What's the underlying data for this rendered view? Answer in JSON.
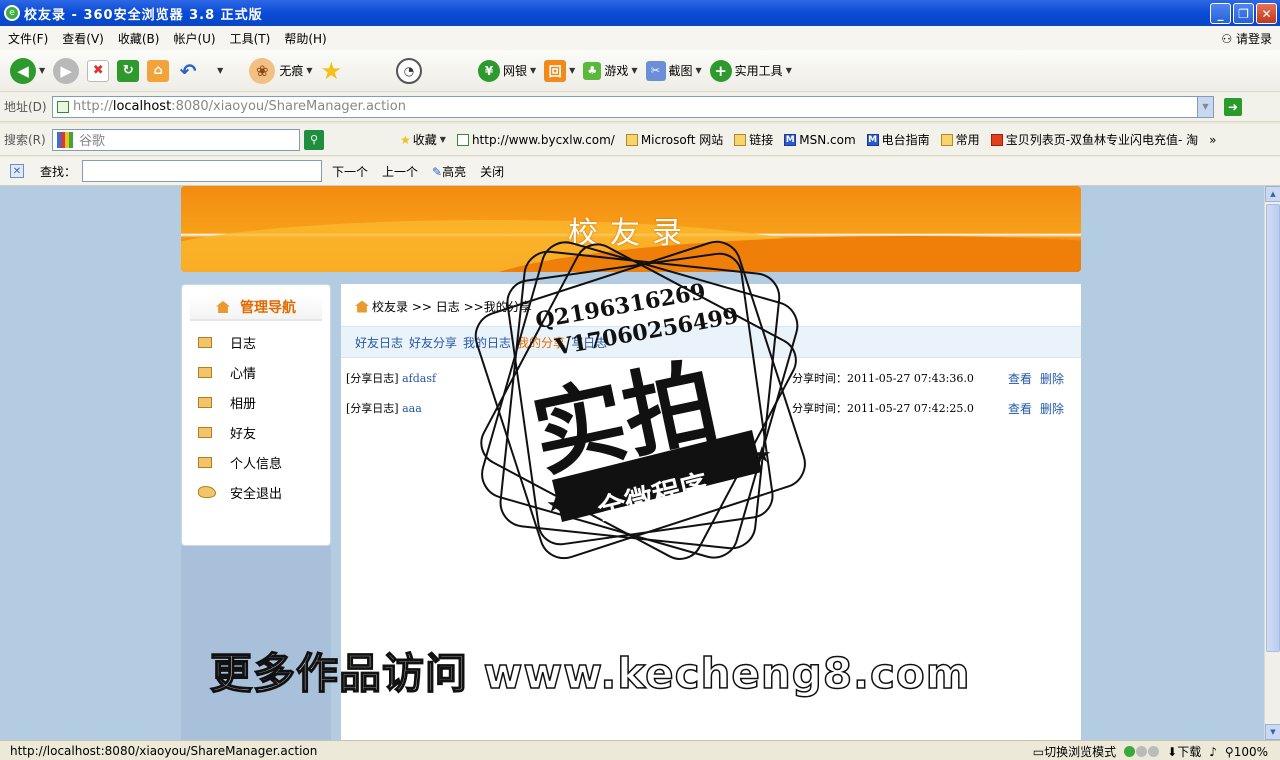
{
  "window": {
    "title": "校友录 - 360安全浏览器 3.8 正式版",
    "buttons": [
      "_",
      "❐",
      "✕"
    ]
  },
  "menu": {
    "items": [
      "文件(F)",
      "查看(V)",
      "收藏(B)",
      "帐户(U)",
      "工具(T)",
      "帮助(H)"
    ],
    "login": "请登录"
  },
  "toolbar": {
    "trace_label": "无痕",
    "bank_label": "网银",
    "game_label": "游戏",
    "screenshot_label": "截图",
    "tools_label": "实用工具"
  },
  "address": {
    "label": "地址(D)",
    "host_prefix": "http://",
    "host": "localhost",
    "host_suffix": ":8080/xiaoyou/ShareManager.action"
  },
  "search": {
    "label": "搜索(R)",
    "placeholder": "谷歌"
  },
  "favorites": {
    "label": "收藏",
    "items": [
      "http://www.bycxlw.com/",
      "Microsoft 网站",
      "链接",
      "MSN.com",
      "电台指南",
      "常用",
      "宝贝列表页-双鱼林专业闪电充值- 淘"
    ],
    "more": "»"
  },
  "findbar": {
    "label": "查找：",
    "next": "下一个",
    "prev": "上一个",
    "highlight": "高亮",
    "close": "关闭"
  },
  "page": {
    "banner_title": "校友录",
    "sidebar": {
      "title": "管理导航",
      "items": [
        "日志",
        "心情",
        "相册",
        "好友",
        "个人信息",
        "安全退出"
      ]
    },
    "breadcrumb": {
      "home": "校友录",
      "sep1": ">>",
      "level1": "日志",
      "sep2": ">>",
      "level2": "我的分享"
    },
    "tabs": [
      "好友日志",
      "好友分享",
      "我的日志",
      "我的分享",
      "写日志"
    ],
    "active_tab": "我的分享",
    "shares": [
      {
        "type": "[分享日志]",
        "title": "afdasf",
        "time_label": "分享时间：",
        "time": "2011-05-27 07:43:36.0",
        "view": "查看",
        "delete": "删除"
      },
      {
        "type": "[分享日志]",
        "title": "aaa",
        "time_label": "分享时间：",
        "time": "2011-05-27 07:42:25.0",
        "view": "查看",
        "delete": "删除"
      }
    ]
  },
  "status": {
    "url": "http://localhost:8080/xiaoyou/ShareManager.action",
    "mode": "切换浏览模式",
    "download": "下载",
    "zoom": "100%"
  },
  "watermark": {
    "text": "更多作品访问 www.kecheng8.com",
    "qq": "Q2196316269",
    "v": "V17060256499",
    "big": "实拍",
    "banner": "全微程序"
  },
  "colors": {
    "title_blue": "#0a4bd6",
    "banner_orange": "#f48b10",
    "link_blue": "#2357a8",
    "active_orange": "#e06b00",
    "page_bg": "#b4cce2"
  }
}
